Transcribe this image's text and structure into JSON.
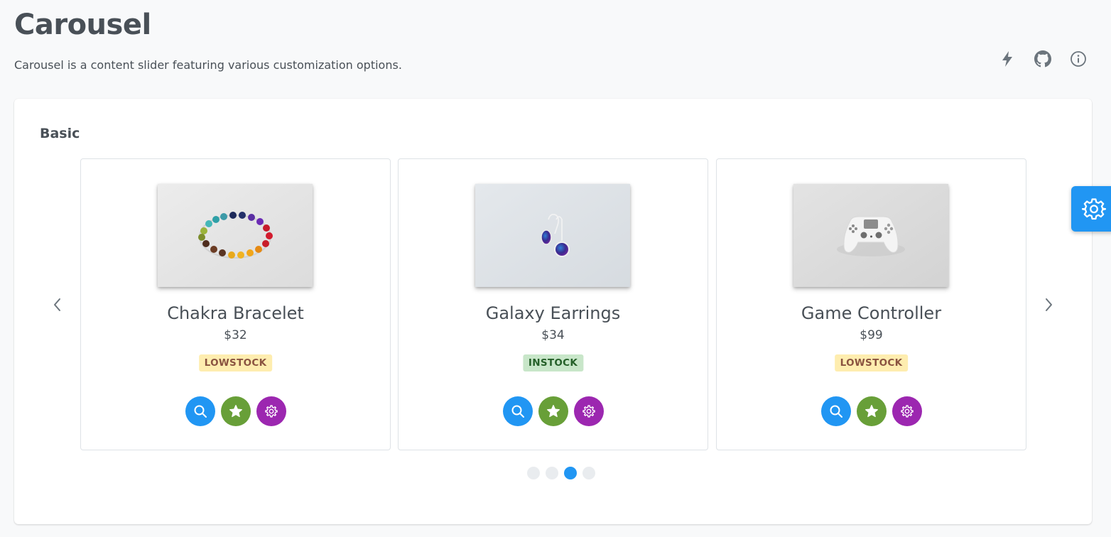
{
  "header": {
    "title": "Carousel",
    "subtitle": "Carousel is a content slider featuring various customization options.",
    "actions": [
      {
        "name": "lightning-icon",
        "label": "Playground"
      },
      {
        "name": "github-icon",
        "label": "GitHub"
      },
      {
        "name": "info-icon",
        "label": "Info"
      }
    ]
  },
  "section": {
    "title": "Basic"
  },
  "carousel": {
    "prev_label": "Previous",
    "next_label": "Next",
    "active_page": 3,
    "page_count": 4,
    "items": [
      {
        "name": "Chakra Bracelet",
        "price": "$32",
        "status": "LOWSTOCK",
        "status_type": "low",
        "image": "bracelet"
      },
      {
        "name": "Galaxy Earrings",
        "price": "$34",
        "status": "INSTOCK",
        "status_type": "in",
        "image": "earrings"
      },
      {
        "name": "Game Controller",
        "price": "$99",
        "status": "LOWSTOCK",
        "status_type": "low",
        "image": "controller"
      }
    ]
  },
  "colors": {
    "primary": "#2196f3",
    "success": "#689f38",
    "help": "#9c27b0",
    "lowstock_bg": "#feedaf",
    "lowstock_text": "#8a5340",
    "instock_bg": "#c8e6c9",
    "instock_text": "#256029"
  },
  "config_button": {
    "icon": "gear-icon",
    "label": "Configurator"
  }
}
